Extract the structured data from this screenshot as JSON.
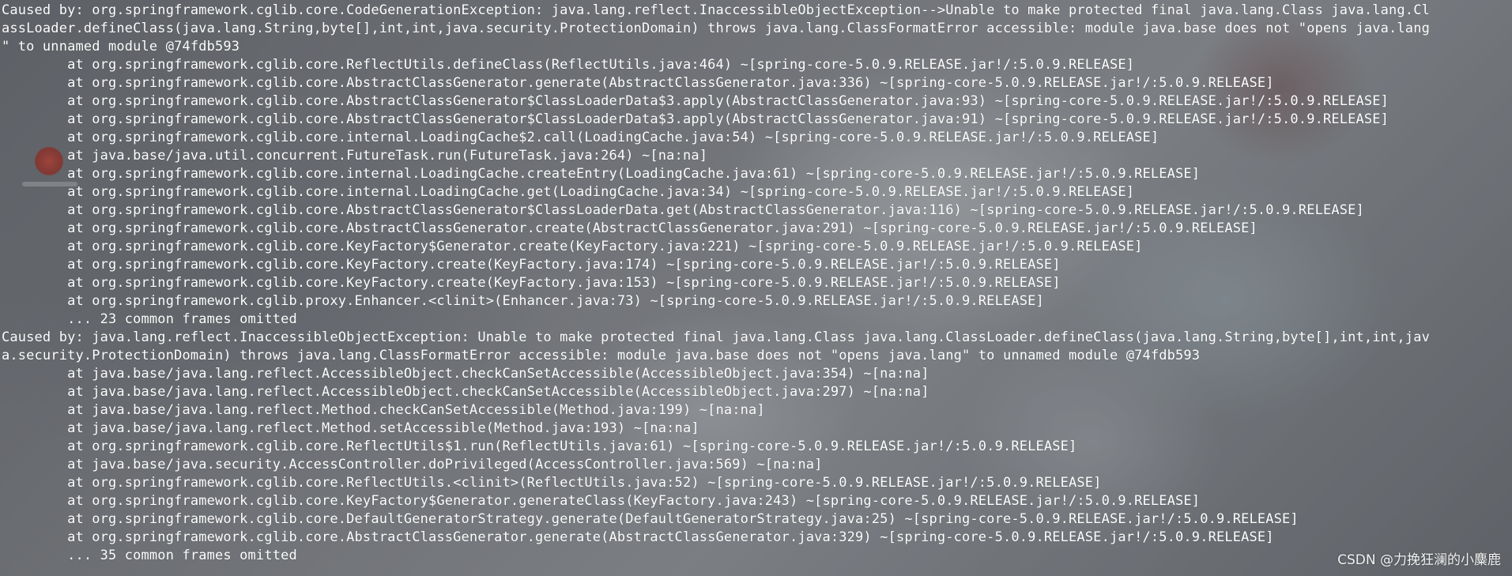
{
  "terminal": {
    "lines": [
      "Caused by: org.springframework.cglib.core.CodeGenerationException: java.lang.reflect.InaccessibleObjectException-->Unable to make protected final java.lang.Class java.lang.Cl",
      "assLoader.defineClass(java.lang.String,byte[],int,int,java.security.ProtectionDomain) throws java.lang.ClassFormatError accessible: module java.base does not \"opens java.lang",
      "\" to unnamed module @74fdb593",
      "        at org.springframework.cglib.core.ReflectUtils.defineClass(ReflectUtils.java:464) ~[spring-core-5.0.9.RELEASE.jar!/:5.0.9.RELEASE]",
      "        at org.springframework.cglib.core.AbstractClassGenerator.generate(AbstractClassGenerator.java:336) ~[spring-core-5.0.9.RELEASE.jar!/:5.0.9.RELEASE]",
      "        at org.springframework.cglib.core.AbstractClassGenerator$ClassLoaderData$3.apply(AbstractClassGenerator.java:93) ~[spring-core-5.0.9.RELEASE.jar!/:5.0.9.RELEASE]",
      "        at org.springframework.cglib.core.AbstractClassGenerator$ClassLoaderData$3.apply(AbstractClassGenerator.java:91) ~[spring-core-5.0.9.RELEASE.jar!/:5.0.9.RELEASE]",
      "        at org.springframework.cglib.core.internal.LoadingCache$2.call(LoadingCache.java:54) ~[spring-core-5.0.9.RELEASE.jar!/:5.0.9.RELEASE]",
      "        at java.base/java.util.concurrent.FutureTask.run(FutureTask.java:264) ~[na:na]",
      "        at org.springframework.cglib.core.internal.LoadingCache.createEntry(LoadingCache.java:61) ~[spring-core-5.0.9.RELEASE.jar!/:5.0.9.RELEASE]",
      "        at org.springframework.cglib.core.internal.LoadingCache.get(LoadingCache.java:34) ~[spring-core-5.0.9.RELEASE.jar!/:5.0.9.RELEASE]",
      "        at org.springframework.cglib.core.AbstractClassGenerator$ClassLoaderData.get(AbstractClassGenerator.java:116) ~[spring-core-5.0.9.RELEASE.jar!/:5.0.9.RELEASE]",
      "        at org.springframework.cglib.core.AbstractClassGenerator.create(AbstractClassGenerator.java:291) ~[spring-core-5.0.9.RELEASE.jar!/:5.0.9.RELEASE]",
      "        at org.springframework.cglib.core.KeyFactory$Generator.create(KeyFactory.java:221) ~[spring-core-5.0.9.RELEASE.jar!/:5.0.9.RELEASE]",
      "        at org.springframework.cglib.core.KeyFactory.create(KeyFactory.java:174) ~[spring-core-5.0.9.RELEASE.jar!/:5.0.9.RELEASE]",
      "        at org.springframework.cglib.core.KeyFactory.create(KeyFactory.java:153) ~[spring-core-5.0.9.RELEASE.jar!/:5.0.9.RELEASE]",
      "        at org.springframework.cglib.proxy.Enhancer.<clinit>(Enhancer.java:73) ~[spring-core-5.0.9.RELEASE.jar!/:5.0.9.RELEASE]",
      "        ... 23 common frames omitted",
      "Caused by: java.lang.reflect.InaccessibleObjectException: Unable to make protected final java.lang.Class java.lang.ClassLoader.defineClass(java.lang.String,byte[],int,int,jav",
      "a.security.ProtectionDomain) throws java.lang.ClassFormatError accessible: module java.base does not \"opens java.lang\" to unnamed module @74fdb593",
      "        at java.base/java.lang.reflect.AccessibleObject.checkCanSetAccessible(AccessibleObject.java:354) ~[na:na]",
      "        at java.base/java.lang.reflect.AccessibleObject.checkCanSetAccessible(AccessibleObject.java:297) ~[na:na]",
      "        at java.base/java.lang.reflect.Method.checkCanSetAccessible(Method.java:199) ~[na:na]",
      "        at java.base/java.lang.reflect.Method.setAccessible(Method.java:193) ~[na:na]",
      "        at org.springframework.cglib.core.ReflectUtils$1.run(ReflectUtils.java:61) ~[spring-core-5.0.9.RELEASE.jar!/:5.0.9.RELEASE]",
      "        at java.base/java.security.AccessController.doPrivileged(AccessController.java:569) ~[na:na]",
      "        at org.springframework.cglib.core.ReflectUtils.<clinit>(ReflectUtils.java:52) ~[spring-core-5.0.9.RELEASE.jar!/:5.0.9.RELEASE]",
      "        at org.springframework.cglib.core.KeyFactory$Generator.generateClass(KeyFactory.java:243) ~[spring-core-5.0.9.RELEASE.jar!/:5.0.9.RELEASE]",
      "        at org.springframework.cglib.core.DefaultGeneratorStrategy.generate(DefaultGeneratorStrategy.java:25) ~[spring-core-5.0.9.RELEASE.jar!/:5.0.9.RELEASE]",
      "        at org.springframework.cglib.core.AbstractClassGenerator.generate(AbstractClassGenerator.java:329) ~[spring-core-5.0.9.RELEASE.jar!/:5.0.9.RELEASE]",
      "        ... 35 common frames omitted"
    ]
  },
  "watermark": {
    "text": "CSDN @力挽狂澜的小麋鹿"
  },
  "colors": {
    "text": "#ffffff",
    "background": "#8a8c91"
  }
}
